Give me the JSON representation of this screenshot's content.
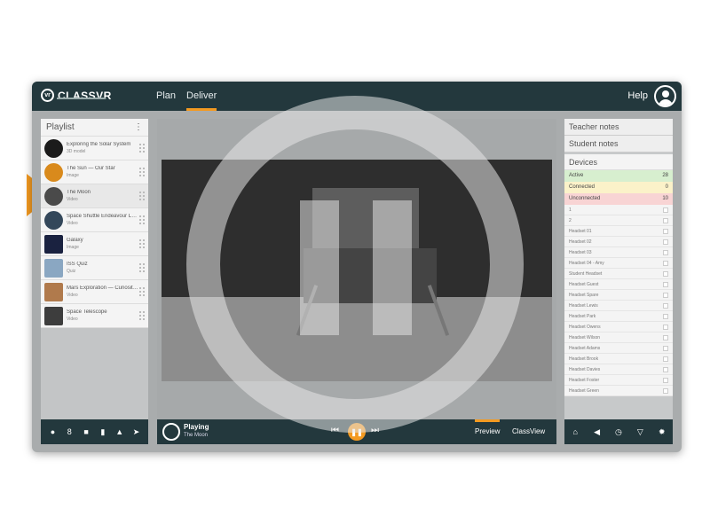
{
  "app": {
    "logo_text": "CLASSVR",
    "logo_mark": "vr",
    "nav": [
      "Plan",
      "Deliver"
    ],
    "help_label": "Help"
  },
  "playlist": {
    "title": "Playlist",
    "menu_icon": "menu-icon",
    "items": [
      {
        "title": "Exploring the Solar System",
        "meta": "3D model",
        "thumb": "#1b1b1b"
      },
      {
        "title": "The Sun — Our Star",
        "meta": "Image",
        "thumb": "#d98a1c"
      },
      {
        "title": "The Moon",
        "meta": "Video",
        "thumb": "#4a4a4a"
      },
      {
        "title": "Space Shuttle Endeavour Launch",
        "meta": "Video",
        "thumb": "#33475a"
      },
      {
        "title": "Galaxy",
        "meta": "Image",
        "thumb": "#1a2240"
      },
      {
        "title": "ISS Quiz",
        "meta": "Quiz",
        "thumb": "#8aa7c2"
      },
      {
        "title": "Mars Exploration — Curiosity Rover",
        "meta": "Video",
        "thumb": "#b07a4c"
      },
      {
        "title": "Space Telescope",
        "meta": "Video",
        "thumb": "#3d3d3d"
      }
    ],
    "toolbar_icons": [
      "user-icon",
      "sequence-icon",
      "save-icon",
      "delete-icon",
      "upload-icon",
      "send-icon"
    ]
  },
  "player": {
    "state_label": "Playing",
    "now_playing": "The Moon",
    "tabs": [
      "Preview",
      "ClassView"
    ],
    "active_tab": "Preview"
  },
  "right": {
    "teacher_notes": "Teacher notes",
    "student_notes": "Student notes",
    "devices_title": "Devices",
    "status": [
      {
        "label": "Active",
        "count": "28",
        "class": "active"
      },
      {
        "label": "Connected",
        "count": "0",
        "class": "connected"
      },
      {
        "label": "Unconnected",
        "count": "10",
        "class": "unconnected"
      }
    ],
    "devices": [
      "1",
      "2",
      "Headset 01",
      "Headset 02",
      "Headset 03",
      "Headset 04 - Amy",
      "Student Headset",
      "Headset Guest",
      "Headset Spare",
      "Headset Lewis",
      "Headset Park",
      "Headset Owens",
      "Headset Wilson",
      "Headset Adams",
      "Headset Brook",
      "Headset Davies",
      "Headset Foster",
      "Headset Green"
    ],
    "toolbar_icons": [
      "home-icon",
      "mute-icon",
      "timer-icon",
      "filter-icon",
      "settings-icon"
    ]
  },
  "colors": {
    "accent": "#f39a21",
    "header": "#23383d"
  }
}
